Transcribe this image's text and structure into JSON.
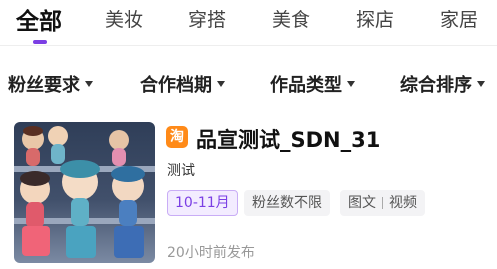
{
  "tabs": [
    {
      "label": "全部",
      "active": true
    },
    {
      "label": "美妆",
      "active": false
    },
    {
      "label": "穿搭",
      "active": false
    },
    {
      "label": "美食",
      "active": false
    },
    {
      "label": "探店",
      "active": false
    },
    {
      "label": "家居",
      "active": false
    }
  ],
  "filters": [
    {
      "label": "粉丝要求"
    },
    {
      "label": "合作档期"
    },
    {
      "label": "作品类型"
    },
    {
      "label": "综合排序"
    }
  ],
  "card": {
    "thumbnail": "toy-figures-photo",
    "platform_badge": "淘",
    "platform_color": "#ff8a18",
    "title": "品宣测试_SDN_31",
    "subtitle": "测试",
    "tags": {
      "period": "10-11月",
      "followers": "粉丝数不限",
      "types": [
        "图文",
        "视频"
      ]
    },
    "time": "20小时前发布"
  },
  "colors": {
    "accent": "#7b3fe4"
  }
}
